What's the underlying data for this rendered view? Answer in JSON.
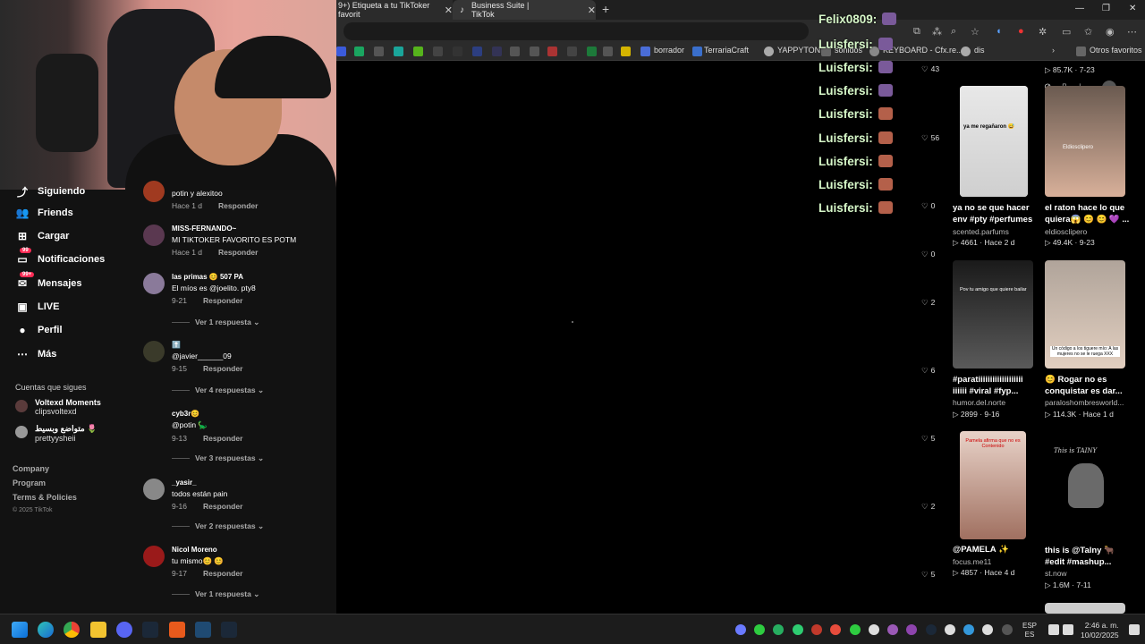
{
  "browser": {
    "tabs": [
      {
        "label": "9+) Etiqueta a tu TikToker favorit",
        "active": false
      },
      {
        "label": "Business Suite | TikTok",
        "active": true
      }
    ],
    "bookmarks": [
      {
        "label": "borrador"
      },
      {
        "label": "TerrariaCraft"
      },
      {
        "label": "YAPPYTON"
      },
      {
        "label": "sonidos"
      },
      {
        "label": "KEYBOARD - Cfx.re..."
      },
      {
        "label": "dis"
      },
      {
        "label": "Otros favoritos"
      }
    ]
  },
  "sidebar": {
    "items": [
      {
        "label": "Siguiendo",
        "icon": "following-icon"
      },
      {
        "label": "Friends",
        "icon": "friends-icon"
      },
      {
        "label": "Cargar",
        "icon": "upload-icon"
      },
      {
        "label": "Notificaciones",
        "icon": "notifications-icon",
        "badge": "99"
      },
      {
        "label": "Mensajes",
        "icon": "messages-icon",
        "badge": "99+"
      },
      {
        "label": "LIVE",
        "icon": "live-icon"
      },
      {
        "label": "Perfil",
        "icon": "profile-icon"
      },
      {
        "label": "Más",
        "icon": "more-icon"
      }
    ],
    "following_title": "Cuentas que sigues",
    "following": [
      {
        "name": "Voltexd Moments",
        "handle": "clipsvoltexd"
      },
      {
        "name": "متواضع وبسيط 🌷",
        "handle": "prettyysheii"
      }
    ],
    "footer": [
      "Company",
      "Program",
      "Terms & Policies"
    ],
    "copyright": "© 2025 TikTok"
  },
  "comments": [
    {
      "user": "",
      "text": "potin y alexitoo",
      "date": "Hace 1 d",
      "reply": "Responder",
      "replies": ""
    },
    {
      "user": "MISS-FERNANDO~",
      "text": "MI TIKTOKER FAVORITO ES POTM",
      "date": "Hace 1 d",
      "reply": "Responder",
      "replies": ""
    },
    {
      "user": "las primas 😊 507 PA",
      "text": "El míos es @joelito. pty8",
      "date": "9-21",
      "reply": "Responder",
      "replies": "Ver 1 respuesta"
    },
    {
      "user": "⬆️",
      "text": "@javier______09",
      "date": "9-15",
      "reply": "Responder",
      "replies": "Ver 4 respuestas"
    },
    {
      "user": "cyb3r😊",
      "text": "@potin 🦕",
      "date": "9-13",
      "reply": "Responder",
      "replies": "Ver 3 respuestas"
    },
    {
      "user": "_yasir_",
      "text": "todos están pain",
      "date": "9-16",
      "reply": "Responder",
      "replies": "Ver 2 respuestas"
    },
    {
      "user": "Nicol Moreno",
      "text": "tu mismo😊 😊",
      "date": "9-17",
      "reply": "Responder",
      "replies": "Ver 1 respuesta"
    }
  ],
  "chat": [
    {
      "name": "Felix0809:"
    },
    {
      "name": "Luisfersi:"
    },
    {
      "name": "Luisfersi:"
    },
    {
      "name": "Luisfersi:"
    },
    {
      "name": "Luisfersi:"
    },
    {
      "name": "Luisfersi:"
    },
    {
      "name": "Luisfersi:"
    },
    {
      "name": "Luisfersi:"
    },
    {
      "name": "Luisfersi:"
    }
  ],
  "likes": [
    "43",
    "56",
    "0",
    "0",
    "2",
    "6",
    "5",
    "2",
    "5"
  ],
  "videos": [
    {
      "title": "",
      "author": "",
      "views": "85.7K",
      "date": "7-23"
    },
    {
      "title": "ya no se que hacer env #pty #perfumes",
      "author": "scented.parfums",
      "views": "4661",
      "date": "Hace 2 d",
      "thumb_text": "ya me regañaron 😅"
    },
    {
      "title": "el raton hace lo que quiera😱 😊 😊 💜 ...",
      "author": "eldiosclipero",
      "views": "49.4K",
      "date": "9-23",
      "thumb_text": "Eldiosclipero"
    },
    {
      "title": "#paratiiiiiiiiiiiiiiiiiii iiiiii #viral #fyp...",
      "author": "humor.del.norte",
      "views": "2899",
      "date": "9-16",
      "thumb_text": "Pov tu amigo que quiere bailar"
    },
    {
      "title": "😊 Rogar no es conquistar es dar...",
      "author": "paraloshombresworld...",
      "views": "114.3K",
      "date": "Hace 1 d",
      "thumb_text": "Un código a los tiguere mío: A las mujeres no se le ruega XXX"
    },
    {
      "title": "@PAMELA ✨",
      "author": "focus.me11",
      "views": "4857",
      "date": "Hace 4 d",
      "thumb_text": "Pamela afirma que no es Contenido"
    },
    {
      "title": "this is @Talny 🐂 #edit #mashup...",
      "author": "st.now",
      "views": "1.6M",
      "date": "7-11",
      "thumb_text": "This is TAINY"
    }
  ],
  "taskbar": {
    "lang_top": "ESP",
    "lang_bottom": "ES",
    "time": "2:46 a. m.",
    "date": "10/02/2025"
  }
}
